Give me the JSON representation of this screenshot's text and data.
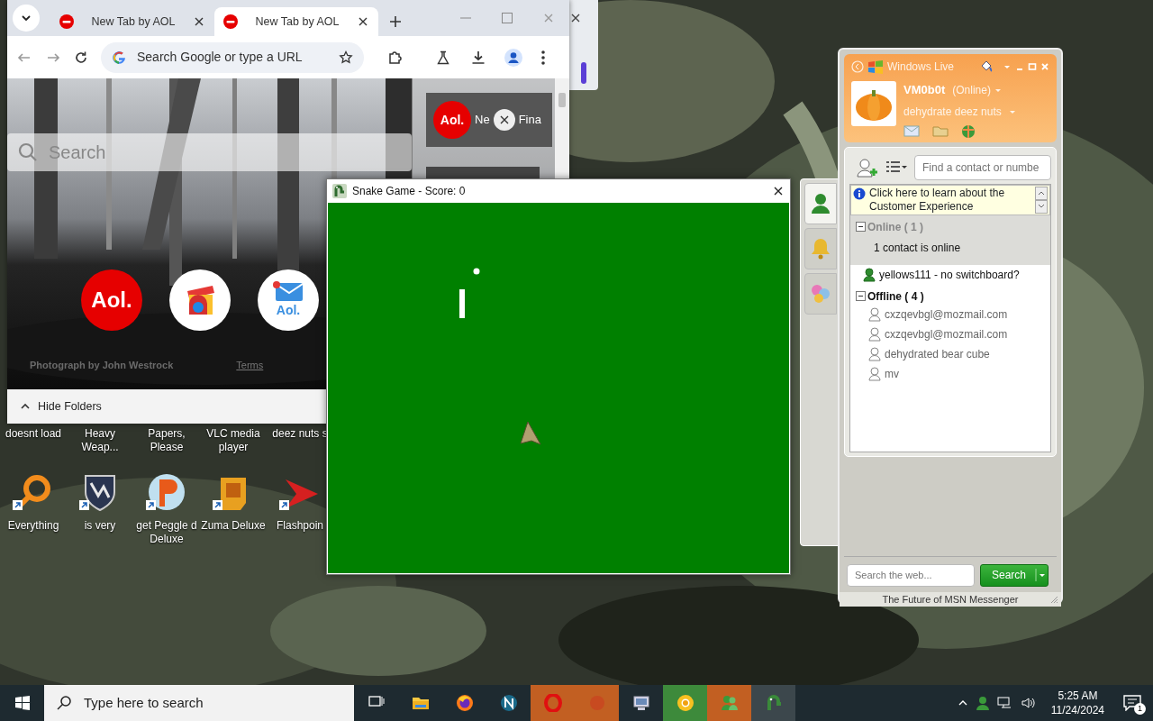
{
  "browser": {
    "tabs": [
      {
        "title": "New Tab by AOL",
        "selected": false
      },
      {
        "title": "New Tab by AOL",
        "selected": true
      }
    ],
    "address": {
      "placeholder": "Search Google or type a URL"
    },
    "new_tab": {
      "search": {
        "placeholder": "Search"
      },
      "shortcuts": [
        {
          "kind": "aol",
          "label": "Aol."
        },
        {
          "kind": "webstore"
        },
        {
          "kind": "mail",
          "label": "Aol."
        }
      ],
      "news_card": {
        "logo": "Aol.",
        "link": "Ne",
        "next_tab": "Fina"
      },
      "photo_credit": "Photograph by John Westrock",
      "terms": "Terms"
    },
    "folders_bar": {
      "label": "Hide Folders",
      "expanded": true
    }
  },
  "desktop_icons": [
    {
      "label": "doesnt load",
      "kind": "hidden"
    },
    {
      "label": "Heavy Weap...",
      "kind": "hidden"
    },
    {
      "label": "Papers, Please",
      "kind": "hidden"
    },
    {
      "label": "VLC media player",
      "kind": "hidden"
    },
    {
      "label": "deez nuts s",
      "kind": "hidden"
    },
    {
      "label": "Everything",
      "kind": "magnifier"
    },
    {
      "label": "is very",
      "kind": "shield"
    },
    {
      "label": "get Peggle d Deluxe",
      "kind": "peggle"
    },
    {
      "label": "Zuma Deluxe",
      "kind": "zuma"
    },
    {
      "label": "Flashpoin",
      "kind": "flashpoint"
    }
  ],
  "snake_game": {
    "title": "Snake Game - Score: 0"
  },
  "messenger": {
    "brand": "Windows Live",
    "user": "VM0b0t",
    "status": "(Online)",
    "personal_message": "dehydrate deez nuts",
    "side_tabs": [
      {
        "kind": "contacts",
        "selected": true
      },
      {
        "kind": "alerts",
        "selected": false
      },
      {
        "kind": "flowers",
        "selected": false
      }
    ],
    "contact_search": {
      "placeholder": "Find a contact or numbe"
    },
    "info_link": "Click here to learn about the Customer Experience",
    "groups": [
      {
        "name": "Online ( 1 )",
        "expanded": true,
        "selected": true,
        "summary": "1 contact is online",
        "contacts": [
          {
            "name": "yellows111 - no switchboard?",
            "online": true
          }
        ]
      },
      {
        "name": "Offline ( 4 )",
        "expanded": true,
        "selected": false,
        "contacts": [
          {
            "name": "cxzqevbgl@mozmail.com",
            "online": false
          },
          {
            "name": "cxzqevbgl@mozmail.com",
            "online": false
          },
          {
            "name": "dehydrated bear cube",
            "online": false
          },
          {
            "name": "mv",
            "online": false
          }
        ]
      }
    ],
    "web_search": {
      "placeholder": "Search the web..."
    },
    "search_button": "Search",
    "footer": "The Future of MSN Messenger"
  },
  "taskbar": {
    "search": {
      "placeholder": "Type here to search"
    },
    "apps": [
      {
        "kind": "task-view",
        "flashing": false,
        "highlighted": false,
        "selected": false
      },
      {
        "kind": "folder",
        "flashing": false,
        "highlighted": false,
        "selected": false
      },
      {
        "kind": "firefox",
        "flashing": false,
        "highlighted": false,
        "selected": false
      },
      {
        "kind": "netscape",
        "flashing": false,
        "highlighted": false,
        "selected": false
      },
      {
        "kind": "opera",
        "flashing": true,
        "highlighted": false,
        "selected": false
      },
      {
        "kind": "blank",
        "flashing": true,
        "highlighted": false,
        "selected": false
      },
      {
        "kind": "remote",
        "flashing": false,
        "highlighted": false,
        "selected": false
      },
      {
        "kind": "chrome",
        "flashing": false,
        "highlighted": true,
        "selected": false
      },
      {
        "kind": "messenger",
        "flashing": true,
        "highlighted": false,
        "selected": false
      },
      {
        "kind": "snake",
        "flashing": false,
        "highlighted": false,
        "selected": true
      }
    ],
    "time": "5:25 AM",
    "date": "11/24/2024",
    "notifications": "1"
  }
}
